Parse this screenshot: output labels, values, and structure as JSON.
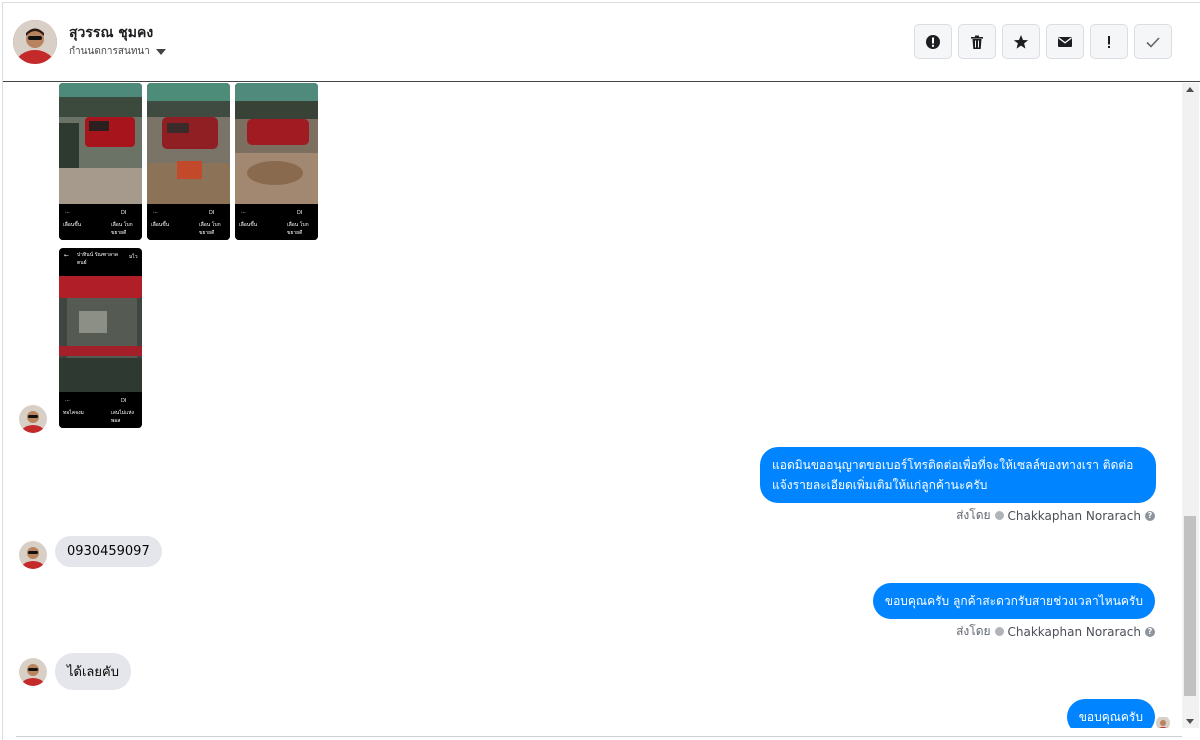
{
  "header": {
    "contact_name": "สุวรรณ ชุมคง",
    "status_label": "กำนนดการสนทนา",
    "actions": [
      {
        "icon": "alert-circle-icon",
        "name": "mark-spam-button"
      },
      {
        "icon": "trash-icon",
        "name": "delete-button"
      },
      {
        "icon": "star-icon",
        "name": "star-button"
      },
      {
        "icon": "envelope-icon",
        "name": "mark-unread-button"
      },
      {
        "icon": "exclamation-icon",
        "name": "mark-important-button"
      },
      {
        "icon": "checkmark-icon",
        "name": "mark-done-button"
      }
    ]
  },
  "photos": [
    {
      "caption_left": "เลื่อนขึ้น",
      "caption_right": "เลื่อน โบกขยายดี"
    },
    {
      "caption_left": "เลื่อนขึ้น",
      "caption_right": "เลื่อน โบกขยายดี"
    },
    {
      "caption_left": "เลื่อนขึ้น",
      "caption_right": "เลื่อน โบกขยายดี"
    },
    {
      "top_text": "ปาทินน์ รัณฑาลาดตนย์",
      "caption_left": "ทอไคจงม",
      "caption_right": "เล่นไม่แห่งพอส"
    }
  ],
  "messages": [
    {
      "dir": "out",
      "text": "แอดมินขออนุญาตขอเบอร์โทรติดต่อเพื่อที่จะให้เซลล์ของทางเรา ติดต่อแจ้งรายละเอียดเพิ่มเติมให้แก่ลูกค้านะครับ",
      "sent_by_label": "ส่งโดย",
      "sent_by": "Chakkaphan Norarach"
    },
    {
      "dir": "in",
      "text": "0930459097"
    },
    {
      "dir": "out",
      "text": "ขอบคุณครับ ลูกค้าสะดวกรับสายช่วงเวลาไหนครับ",
      "sent_by_label": "ส่งโดย",
      "sent_by": "Chakkaphan Norarach"
    },
    {
      "dir": "in",
      "text": "ได้เลยคับ"
    },
    {
      "dir": "out",
      "text": "ขอบคุณครับ"
    }
  ],
  "colors": {
    "accent": "#0084ff",
    "incoming": "#e4e6eb"
  }
}
